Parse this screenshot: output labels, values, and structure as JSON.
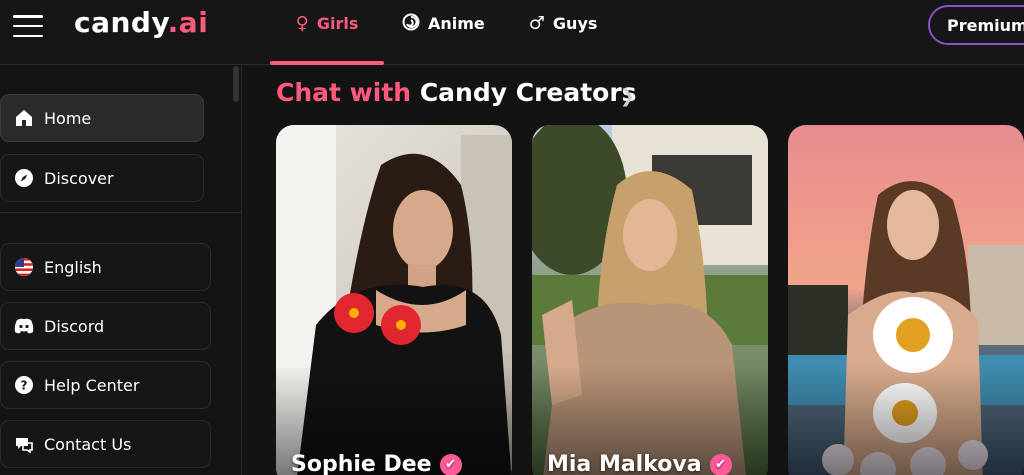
{
  "header": {
    "logo_main": "candy",
    "logo_accent": ".ai",
    "tabs": [
      {
        "label": "Girls",
        "icon": "female-icon"
      },
      {
        "label": "Anime",
        "icon": "anime-swirl-icon"
      },
      {
        "label": "Guys",
        "icon": "male-icon"
      }
    ],
    "premium_label": "Premium"
  },
  "sidebar": {
    "items": [
      {
        "label": "Home",
        "icon": "home-icon"
      },
      {
        "label": "Discover",
        "icon": "compass-icon"
      },
      {
        "label": "English",
        "icon": "us-flag-icon"
      },
      {
        "label": "Discord",
        "icon": "discord-icon"
      },
      {
        "label": "Help Center",
        "icon": "help-icon"
      },
      {
        "label": "Contact Us",
        "icon": "contact-icon"
      }
    ]
  },
  "main": {
    "title_pink": "Chat with",
    "title_white": "Candy Creators",
    "cards": [
      {
        "name": "Sophie Dee"
      },
      {
        "name": "Mia Malkova"
      },
      {
        "name": ""
      }
    ]
  },
  "colors": {
    "accent": "#ff5a7e",
    "premium_border": "#8a4ec9",
    "verified": "#ff5a9a"
  }
}
